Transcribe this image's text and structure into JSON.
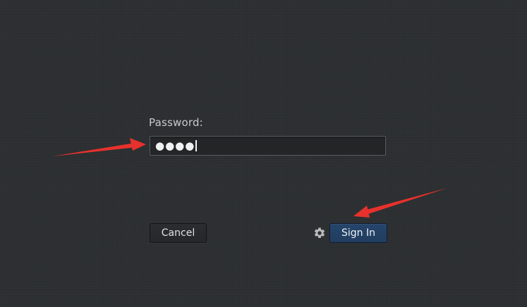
{
  "login": {
    "password_label": "Password:",
    "password_value": "●●●●",
    "cancel_label": "Cancel",
    "signin_label": "Sign In",
    "settings_icon": "gear-icon"
  },
  "colors": {
    "background": "#2c2f31",
    "primary_button": "#26456b",
    "annotation": "#e8312c"
  }
}
